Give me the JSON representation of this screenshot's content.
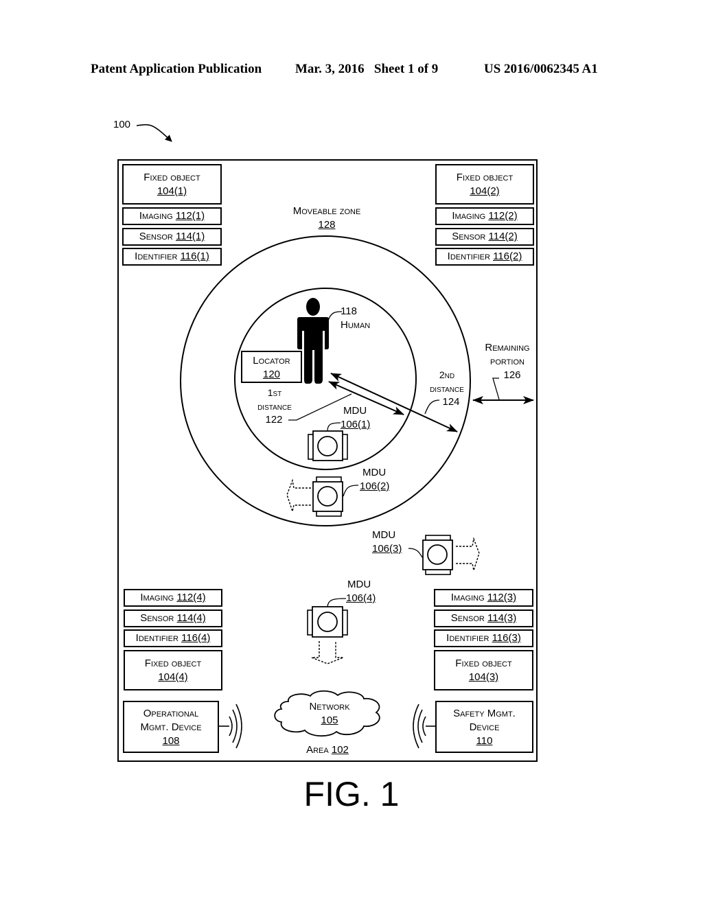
{
  "header": {
    "left": "Patent Application Publication",
    "middle": "Mar. 3, 2016   Sheet 1 of 9",
    "right": "US 2016/0062345 A1"
  },
  "figure_ref": "100",
  "area": {
    "label": "Area",
    "num": "102"
  },
  "moveable_zone": {
    "label": "Moveable zone",
    "num": "128"
  },
  "human": {
    "num": "118",
    "label": "Human"
  },
  "locator": {
    "label": "Locator",
    "num": "120"
  },
  "first_distance": {
    "line1": "1st",
    "line2": "distance",
    "num": "122"
  },
  "second_distance": {
    "line1": "2nd",
    "line2": "distance",
    "num": "124"
  },
  "remaining_portion": {
    "line1": "Remaining",
    "line2": "portion",
    "num": "126"
  },
  "mdus": [
    {
      "label": "MDU",
      "num": "106(1)"
    },
    {
      "label": "MDU",
      "num": "106(2)"
    },
    {
      "label": "MDU",
      "num": "106(3)"
    },
    {
      "label": "MDU",
      "num": "106(4)"
    }
  ],
  "corners": {
    "top_left": {
      "fixed_label": "Fixed object",
      "fixed_num": "104(1)",
      "imaging_label": "Imaging",
      "imaging_num": "112(1)",
      "sensor_label": "Sensor",
      "sensor_num": "114(1)",
      "identifier_label": "Identifier",
      "identifier_num": "116(1)"
    },
    "top_right": {
      "fixed_label": "Fixed object",
      "fixed_num": "104(2)",
      "imaging_label": "Imaging",
      "imaging_num": "112(2)",
      "sensor_label": "Sensor",
      "sensor_num": "114(2)",
      "identifier_label": "Identifier",
      "identifier_num": "116(2)"
    },
    "bottom_right": {
      "fixed_label": "Fixed object",
      "fixed_num": "104(3)",
      "imaging_label": "Imaging",
      "imaging_num": "112(3)",
      "sensor_label": "Sensor",
      "sensor_num": "114(3)",
      "identifier_label": "Identifier",
      "identifier_num": "116(3)"
    },
    "bottom_left": {
      "fixed_label": "Fixed object",
      "fixed_num": "104(4)",
      "imaging_label": "Imaging",
      "imaging_num": "112(4)",
      "sensor_label": "Sensor",
      "sensor_num": "114(4)",
      "identifier_label": "Identifier",
      "identifier_num": "116(4)"
    }
  },
  "operational_device": {
    "line1": "Operational",
    "line2": "Mgmt. Device",
    "num": "108"
  },
  "network": {
    "label": "Network",
    "num": "105"
  },
  "safety_device": {
    "line1": "Safety Mgmt.",
    "line2": "Device",
    "num": "110"
  },
  "figure_caption": "FIG. 1"
}
